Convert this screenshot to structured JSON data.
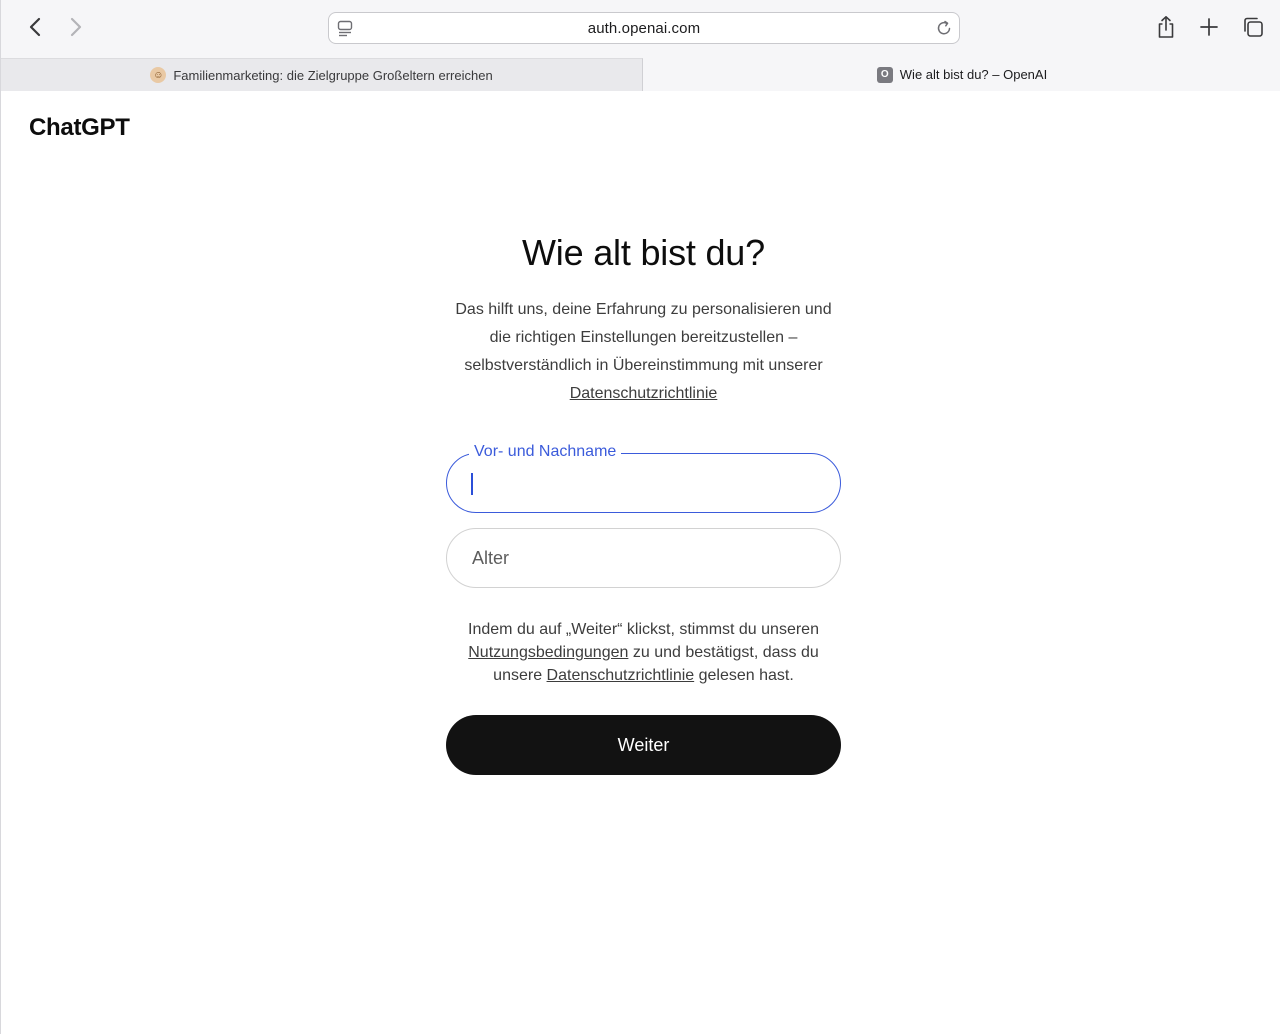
{
  "browser": {
    "url": "auth.openai.com",
    "tabs": [
      {
        "label": "Familienmarketing: die Zielgruppe Großeltern erreichen",
        "active": false
      },
      {
        "label": "Wie alt bist du? – OpenAI",
        "active": true,
        "favicon_letter": "O"
      }
    ]
  },
  "page": {
    "brand": "ChatGPT",
    "title": "Wie alt bist du?",
    "subtitle": "Das hilft uns, deine Erfahrung zu personalisieren und die richtigen Einstellungen bereitzustellen – selbstverständlich in Übereinstimmung mit unserer",
    "privacy_link": "Datenschutzrichtlinie",
    "name_field": {
      "label": "Vor- und Nachname",
      "value": ""
    },
    "age_field": {
      "placeholder": "Alter",
      "value": ""
    },
    "terms": {
      "part1": "Indem du auf „Weiter“ klickst, stimmst du unseren",
      "terms_link": "Nutzungsbedingungen",
      "part2": "zu und bestätigst, dass du unsere",
      "privacy_link": "Datenschutzrichtlinie",
      "part3": "gelesen hast."
    },
    "continue_label": "Weiter"
  },
  "colors": {
    "accent": "#3b5bdb",
    "button_bg": "#121212",
    "text": "#0d0d0d"
  }
}
